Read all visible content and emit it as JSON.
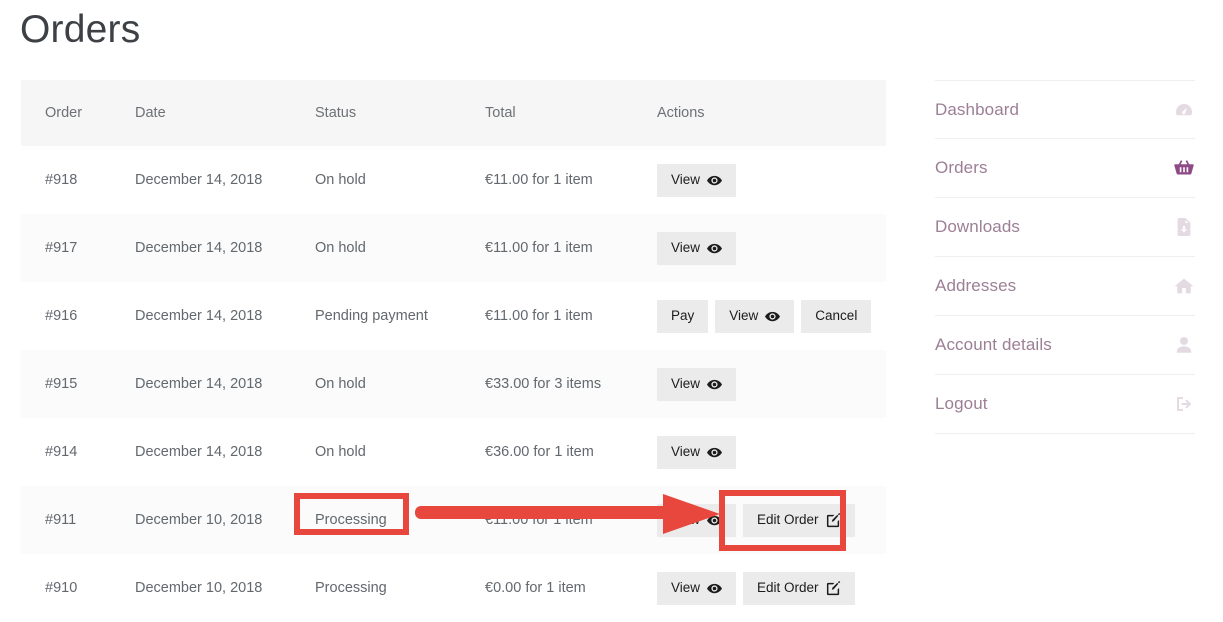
{
  "page": {
    "title": "Orders"
  },
  "table": {
    "columns": [
      {
        "key": "order",
        "label": "Order"
      },
      {
        "key": "date",
        "label": "Date"
      },
      {
        "key": "status",
        "label": "Status"
      },
      {
        "key": "total",
        "label": "Total"
      },
      {
        "key": "actions",
        "label": "Actions"
      }
    ],
    "rows": [
      {
        "order": "#918",
        "date": "December 14, 2018",
        "status": "On hold",
        "total": "€11.00 for 1 item",
        "actions": [
          {
            "label": "View",
            "icon": "eye-icon"
          }
        ]
      },
      {
        "order": "#917",
        "date": "December 14, 2018",
        "status": "On hold",
        "total": "€11.00 for 1 item",
        "actions": [
          {
            "label": "View",
            "icon": "eye-icon"
          }
        ]
      },
      {
        "order": "#916",
        "date": "December 14, 2018",
        "status": "Pending payment",
        "total": "€11.00 for 1 item",
        "actions": [
          {
            "label": "Pay",
            "icon": ""
          },
          {
            "label": "View",
            "icon": "eye-icon"
          },
          {
            "label": "Cancel",
            "icon": ""
          }
        ]
      },
      {
        "order": "#915",
        "date": "December 14, 2018",
        "status": "On hold",
        "total": "€33.00 for 3 items",
        "actions": [
          {
            "label": "View",
            "icon": "eye-icon"
          }
        ]
      },
      {
        "order": "#914",
        "date": "December 14, 2018",
        "status": "On hold",
        "total": "€36.00 for 1 item",
        "actions": [
          {
            "label": "View",
            "icon": "eye-icon"
          }
        ]
      },
      {
        "order": "#911",
        "date": "December 10, 2018",
        "status": "Processing",
        "total": "€11.00 for 1 item",
        "actions": [
          {
            "label": "View",
            "icon": "eye-icon"
          },
          {
            "label": "Edit Order",
            "icon": "pencil-square-icon"
          }
        ]
      },
      {
        "order": "#910",
        "date": "December 10, 2018",
        "status": "Processing",
        "total": "€0.00 for 1 item",
        "actions": [
          {
            "label": "View",
            "icon": "eye-icon"
          },
          {
            "label": "Edit Order",
            "icon": "pencil-square-icon"
          }
        ]
      }
    ]
  },
  "sidebar": {
    "items": [
      {
        "label": "Dashboard",
        "icon": "dashboard-gauge-icon",
        "active": false
      },
      {
        "label": "Orders",
        "icon": "shopping-basket-icon",
        "active": true
      },
      {
        "label": "Downloads",
        "icon": "file-download-icon",
        "active": false
      },
      {
        "label": "Addresses",
        "icon": "home-icon",
        "active": false
      },
      {
        "label": "Account details",
        "icon": "user-icon",
        "active": false
      },
      {
        "label": "Logout",
        "icon": "logout-arrow-icon",
        "active": false
      }
    ]
  },
  "annotations": {
    "highlight_color": "#e8473d",
    "status_box_target": "Processing",
    "edit_box_target": "Edit Order",
    "arrow_direction": "right"
  },
  "colors": {
    "accent_purple": "#8e4a86",
    "muted_purple": "#9c7f95",
    "text": "#62686d",
    "header_bg": "#f6f6f6",
    "row_alt_bg": "#fbfbfb",
    "button_bg": "#ebebeb",
    "annotation_red": "#e8473d"
  }
}
